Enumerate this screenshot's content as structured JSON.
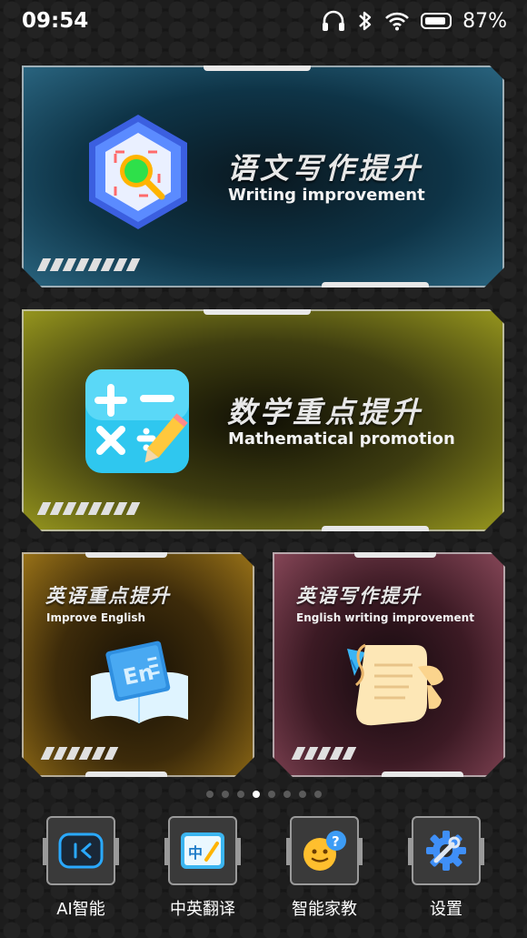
{
  "status_bar": {
    "time": "09:54",
    "battery": "87%"
  },
  "cards": {
    "writing": {
      "title": "语文写作提升",
      "subtitle": "Writing improvement"
    },
    "math": {
      "title": "数学重点提升",
      "subtitle": "Mathematical promotion"
    },
    "english": {
      "title": "英语重点提升",
      "subtitle": "Improve English"
    },
    "english_writing": {
      "title": "英语写作提升",
      "subtitle": "English writing improvement"
    }
  },
  "page_indicator": {
    "count": 8,
    "active_index": 3
  },
  "dock": {
    "ai": "AI智能",
    "translate": "中英翻译",
    "tutor": "智能家教",
    "settings": "设置"
  },
  "icons": {
    "ai_icon_text": "I<",
    "translate_icon_text": "中"
  },
  "colors": {
    "writing_card": "#0e3447",
    "math_card": "#3e3d10",
    "english_card": "#3d2b0a",
    "english_writing_card": "#3c1a24"
  }
}
